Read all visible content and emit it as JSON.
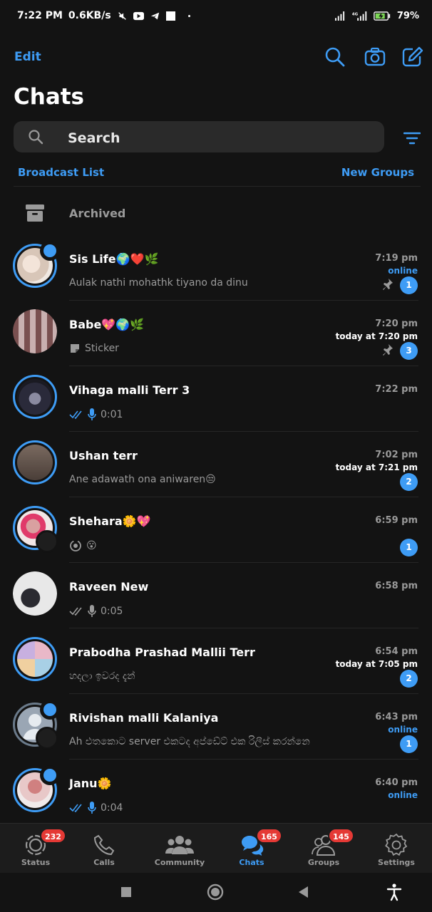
{
  "status_bar": {
    "time": "7:22 PM",
    "speed": "0.6KB/s",
    "battery": "79%"
  },
  "header": {
    "edit_label": "Edit",
    "title": "Chats",
    "search_placeholder": "Search",
    "broadcast_label": "Broadcast List",
    "new_groups_label": "New Groups",
    "archived_label": "Archived"
  },
  "chats": [
    {
      "name": "Sis Life🌍❤️🌿",
      "preview": "Aulak nathi mohathk tiyano da dinu",
      "time": "7:19 pm",
      "sub": "online",
      "count": "1"
    },
    {
      "name": "Babe💖🌍🌿",
      "preview": "Sticker",
      "time": "7:20 pm",
      "sub": "today at 7:20 pm",
      "count": "3"
    },
    {
      "name": "Vihaga malli Terr 3",
      "preview": "0:01",
      "time": "7:22 pm",
      "sub": "",
      "count": ""
    },
    {
      "name": "Ushan terr",
      "preview": "Ane adawath ona aniwaren😒",
      "time": "7:02 pm",
      "sub": "today at 7:21 pm",
      "count": "2"
    },
    {
      "name": "Shehara🌼💖",
      "preview": "😮",
      "time": "6:59 pm",
      "sub": "",
      "count": "1"
    },
    {
      "name": "Raveen New",
      "preview": "0:05",
      "time": "6:58 pm",
      "sub": "",
      "count": ""
    },
    {
      "name": "Prabodha Prashad Mallii Terr",
      "preview": "හදලා ඉවරද දැන්",
      "time": "6:54 pm",
      "sub": "today at 7:05 pm",
      "count": "2"
    },
    {
      "name": "Rivishan malli Kalaniya",
      "preview": "Ah එතකොට server එකටද අප්ඩේට් එක රිලීස් කරන්නෙ",
      "time": "6:43 pm",
      "sub": "online",
      "count": "1"
    },
    {
      "name": "Janu🌼",
      "preview": "0:04",
      "time": "6:40 pm",
      "sub": "online",
      "count": ""
    }
  ],
  "bottom_nav": [
    {
      "label": "Status",
      "badge": "232"
    },
    {
      "label": "Calls",
      "badge": ""
    },
    {
      "label": "Community",
      "badge": ""
    },
    {
      "label": "Chats",
      "badge": "165"
    },
    {
      "label": "Groups",
      "badge": "145"
    },
    {
      "label": "Settings",
      "badge": ""
    }
  ],
  "colors": {
    "accent": "#3e9cf5",
    "badge_red": "#e53935",
    "background": "#131313"
  }
}
